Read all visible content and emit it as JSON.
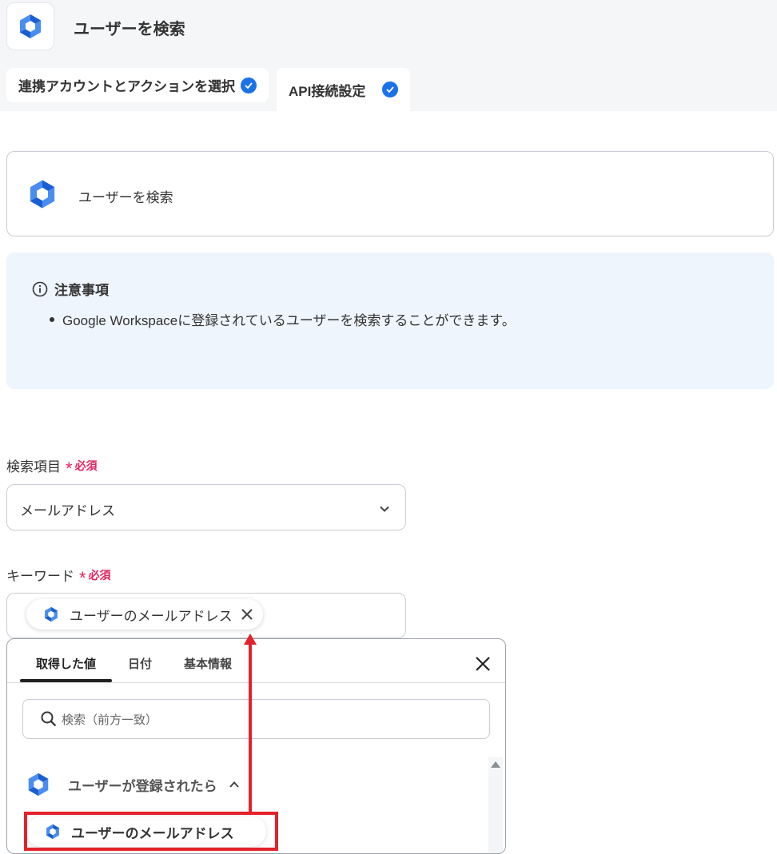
{
  "header": {
    "title": "ユーザーを検索",
    "app_icon": "google-workspace-icon",
    "tabs": [
      {
        "label": "連携アカウントとアクションを選択",
        "done": true
      },
      {
        "label": "API接続設定",
        "done": true
      }
    ]
  },
  "action_card": {
    "label": "ユーザーを検索",
    "icon": "google-workspace-icon"
  },
  "notice": {
    "title": "注意事項",
    "items": [
      "Google Workspaceに登録されているユーザーを検索することができます。"
    ]
  },
  "fields": {
    "search_item": {
      "label": "検索項目",
      "required_label": "必須",
      "value": "メールアドレス"
    },
    "keyword": {
      "label": "キーワード",
      "required_label": "必須",
      "chip_label": "ユーザーのメールアドレス"
    }
  },
  "popup": {
    "tabs": [
      "取得した値",
      "日付",
      "基本情報"
    ],
    "active_tab": "取得した値",
    "search_placeholder": "検索（前方一致）",
    "group_label": "ユーザーが登録されたら",
    "option_label": "ユーザーのメールアドレス"
  },
  "colors": {
    "accent_blue": "#1b72e8",
    "required_red": "#e0245e",
    "annotation_red": "#e3222b",
    "notice_bg": "#eef5fd"
  }
}
